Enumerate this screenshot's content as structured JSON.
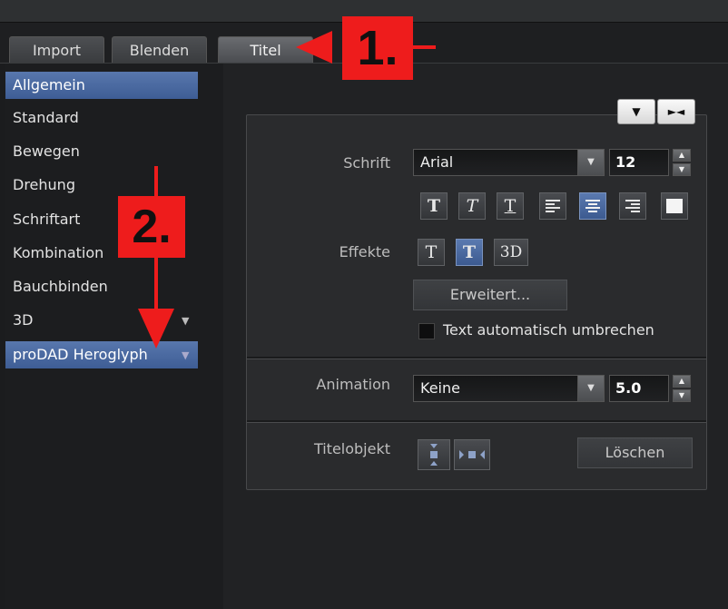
{
  "tabs": [
    {
      "label": "Import"
    },
    {
      "label": "Blenden"
    },
    {
      "label": "Titel"
    }
  ],
  "sidebar": {
    "items": [
      {
        "label": "Allgemein"
      },
      {
        "label": "Standard"
      },
      {
        "label": "Bewegen"
      },
      {
        "label": "Drehung"
      },
      {
        "label": "Schriftart"
      },
      {
        "label": "Kombination"
      },
      {
        "label": "Bauchbinden"
      },
      {
        "label": "3D"
      },
      {
        "label": "proDAD Heroglyph"
      }
    ]
  },
  "panel": {
    "header_buttons": {
      "expand": "▼",
      "collapse": "►◄"
    },
    "schrift": {
      "label": "Schrift",
      "font": "Arial",
      "size": "12"
    },
    "format_buttons": {
      "bold": "T",
      "italic": "T",
      "underline": "T"
    },
    "effekte": {
      "label": "Effekte",
      "shadow": "T",
      "outline": "T",
      "three_d": "3D"
    },
    "erweitert": "Erweitert...",
    "wrap_label": "Text automatisch umbrechen",
    "animation": {
      "label": "Animation",
      "value": "Keine",
      "duration": "5.0"
    },
    "titelobjekt": {
      "label": "Titelobjekt",
      "delete": "Löschen"
    }
  },
  "annotations": {
    "step1": "1.",
    "step2": "2."
  },
  "colors": {
    "accent_selected": "#4a6aa3",
    "annotation_red": "#ee1c1c"
  }
}
